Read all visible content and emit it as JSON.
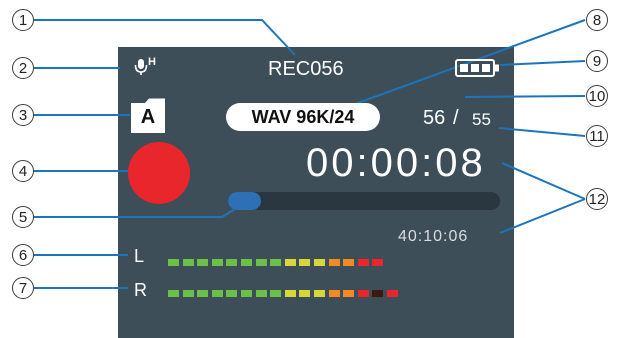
{
  "screen": {
    "file_name": "REC056",
    "mic_indicator": "H",
    "format": "WAV 96K/24",
    "folder": "A",
    "file_index": "56",
    "file_total": "55",
    "elapsed_time": "00:00:08",
    "remaining_time": "40:10:06",
    "progress": 0.08,
    "channel_left_label": "L",
    "channel_right_label": "R",
    "level_left_segments": 15,
    "level_right_segments": 16
  },
  "callouts": [
    "1",
    "2",
    "3",
    "4",
    "5",
    "6",
    "7",
    "8",
    "9",
    "10",
    "11",
    "12"
  ],
  "colors": {
    "screen_bg": "#3d4e59",
    "record_button": "#e8262b",
    "progress_fill": "#2f6fb5",
    "progress_track": "#2a3640",
    "callout_line": "#1c75bc",
    "meter_green": "#6cc04a",
    "meter_yellow": "#d8d63a",
    "meter_orange": "#f08a24",
    "meter_red": "#e8262b"
  },
  "icons": [
    "microphone-icon",
    "folder-icon",
    "battery-icon",
    "record-icon"
  ]
}
